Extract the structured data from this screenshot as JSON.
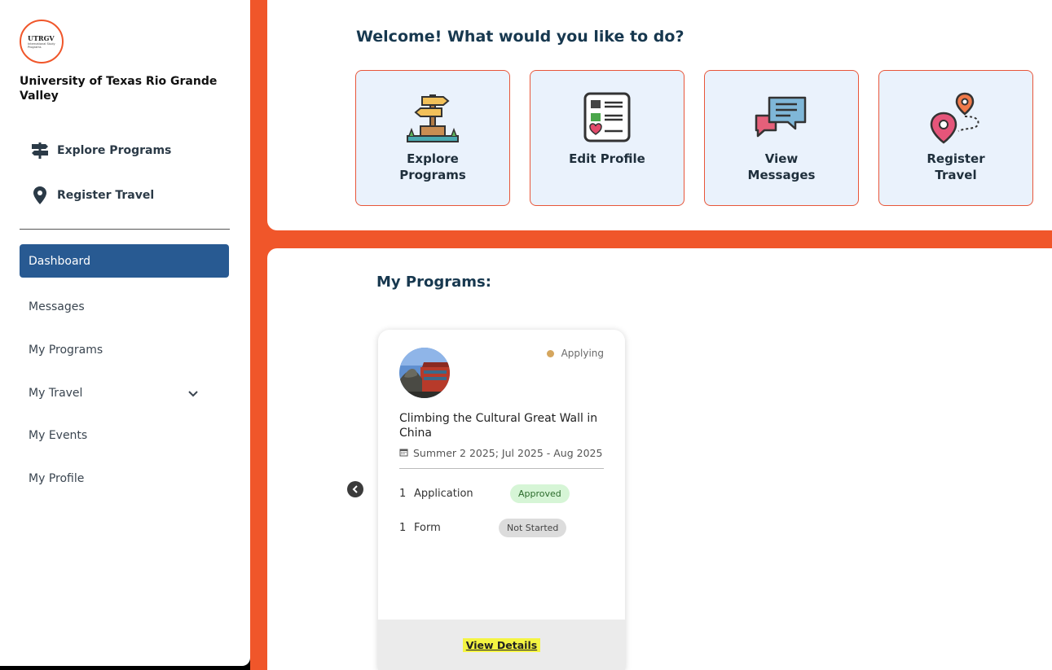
{
  "sidebar": {
    "logo": {
      "main": "UTRGV",
      "sub": "International Study Programs"
    },
    "university_name": "University of Texas Rio Grande Valley",
    "quick_links": [
      {
        "label": "Explore Programs",
        "icon": "signpost-icon"
      },
      {
        "label": "Register Travel",
        "icon": "map-pin-icon"
      }
    ],
    "nav": [
      {
        "label": "Dashboard",
        "active": true
      },
      {
        "label": "Messages"
      },
      {
        "label": "My Programs"
      },
      {
        "label": "My Travel",
        "expandable": true
      },
      {
        "label": "My Events"
      },
      {
        "label": "My Profile"
      }
    ]
  },
  "welcome": {
    "title": "Welcome! What would you like to do?",
    "tiles": [
      {
        "label": "Explore Programs",
        "icon": "signpost-icon"
      },
      {
        "label": "Edit Profile",
        "icon": "profile-form-icon"
      },
      {
        "label": "View Messages",
        "icon": "chat-bubbles-icon"
      },
      {
        "label": "Register Travel",
        "icon": "route-pins-icon"
      }
    ]
  },
  "programs": {
    "title": "My Programs:",
    "cards": [
      {
        "status": "Applying",
        "title": "Climbing the Cultural Great Wall in China",
        "term": "Summer 2 2025; Jul 2025 - Aug 2025",
        "requirements": [
          {
            "count": "1",
            "label": "Application",
            "badge": "Approved"
          },
          {
            "count": "1",
            "label": "Form",
            "badge": "Not Started"
          }
        ],
        "link": "View Details"
      }
    ]
  },
  "colors": {
    "accent_orange": "#f0562a",
    "nav_active": "#285a92",
    "tile_bg": "#eaf2fc",
    "status_dot": "#d5a65e"
  }
}
